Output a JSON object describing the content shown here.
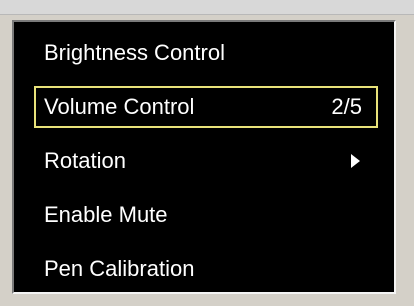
{
  "menu": {
    "items": [
      {
        "label": "Brightness Control",
        "value": ""
      },
      {
        "label": "Volume Control",
        "value": "2/5",
        "selected": true
      },
      {
        "label": "Rotation",
        "value": "",
        "submenu": true,
        "icon": "submenu-arrow-icon"
      },
      {
        "label": "Enable Mute",
        "value": ""
      },
      {
        "label": "Pen Calibration",
        "value": ""
      }
    ]
  },
  "colors": {
    "background": "#000000",
    "text": "#ffffff",
    "selection_border": "#e8e27a",
    "chrome": "#d4d0c8"
  }
}
